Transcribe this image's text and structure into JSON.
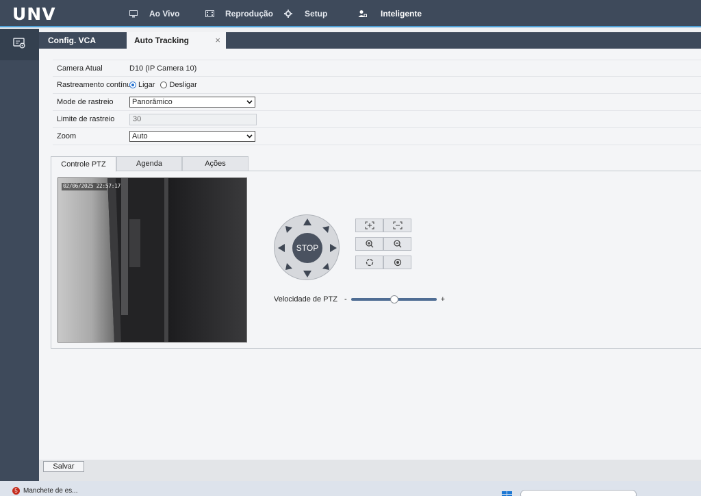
{
  "app": {
    "logo": "UNV",
    "nav": [
      {
        "label": "Ao Vivo",
        "icon": "monitor-icon"
      },
      {
        "label": "Reprodução",
        "icon": "film-icon"
      },
      {
        "label": "Setup",
        "icon": "gear-icon"
      },
      {
        "label": "Inteligente",
        "icon": "person-scan-icon"
      }
    ],
    "active_nav": "Inteligente"
  },
  "sidebar": {
    "items": [
      {
        "icon": "vca-settings-icon"
      }
    ]
  },
  "tabs": [
    {
      "label": "Config. VCA"
    },
    {
      "label": "Auto Tracking",
      "closable": true,
      "close_symbol": "×"
    }
  ],
  "form": {
    "camera_label": "Camera Atual",
    "camera_value": "D10 (IP Camera 10)",
    "continuous_label": "Rastreamento contínuo",
    "continuous_on": "Ligar",
    "continuous_off": "Desligar",
    "continuous_selected": "Ligar",
    "mode_label": "Mode de rastreio",
    "mode_value": "Panorâmico",
    "limit_label": "Limite de rastreio",
    "limit_value": "30",
    "zoom_label": "Zoom",
    "zoom_value": "Auto"
  },
  "ptz_tabs": [
    {
      "label": "Controle PTZ"
    },
    {
      "label": "Agenda"
    },
    {
      "label": "Ações"
    }
  ],
  "ptz": {
    "timestamp": "02/06/2025 22:57:17",
    "stop_label": "STOP",
    "speed_label": "Velocidade de PTZ",
    "speed_min": "-",
    "speed_max": "+",
    "speed_value_fraction": 0.5,
    "buttons": [
      "focus-near-icon",
      "focus-far-icon",
      "zoom-in-icon",
      "zoom-out-icon",
      "iris-open-icon",
      "iris-close-icon"
    ]
  },
  "footer": {
    "save_label": "Salvar"
  },
  "taskbar": {
    "item_label": "Manchete de es...",
    "item_badge": "5"
  },
  "colors": {
    "nav_bg": "#3e4a5b",
    "accent": "#4ea1d8",
    "content_bg": "#f4f5f7",
    "stop_bg": "#4a5260"
  }
}
